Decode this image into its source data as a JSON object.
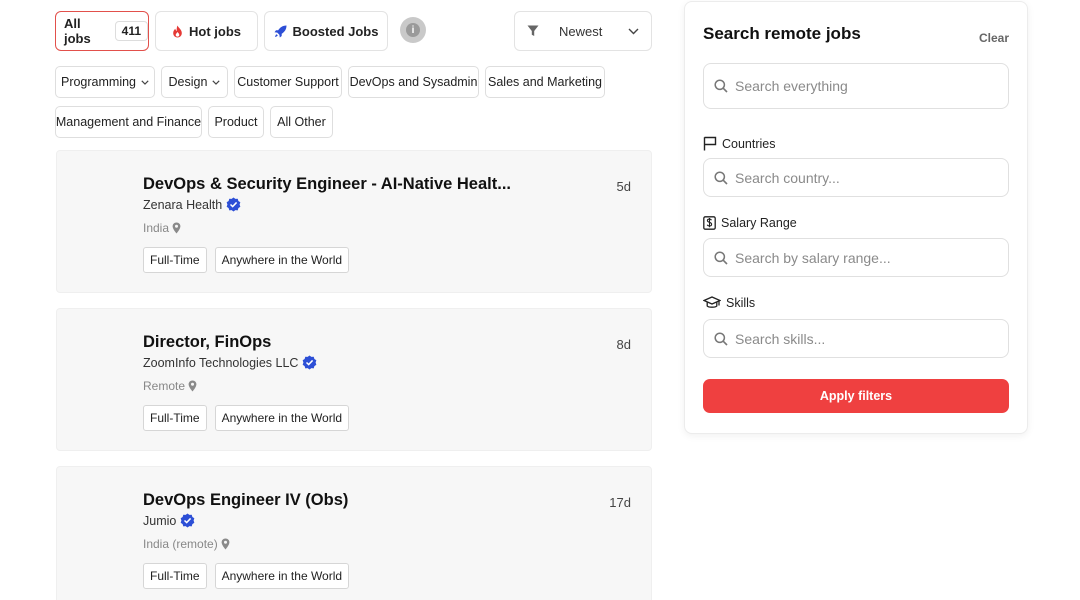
{
  "tabs": {
    "all_label": "All jobs",
    "all_count": "411",
    "hot_label": "Hot jobs",
    "boosted_label": "Boosted Jobs",
    "info_glyph": "i"
  },
  "sort": {
    "selected": "Newest"
  },
  "categories": [
    "Programming",
    "Design",
    "Customer Support",
    "DevOps and Sysadmin",
    "Sales and Marketing",
    "Management and Finance",
    "Product",
    "All Other"
  ],
  "jobs": [
    {
      "title": "DevOps & Security Engineer - AI-Native Healt...",
      "company": "Zenara Health",
      "location": "India",
      "age": "5d",
      "tags": [
        "Full-Time",
        "Anywhere in the World"
      ]
    },
    {
      "title": "Director, FinOps",
      "company": "ZoomInfo Technologies LLC",
      "location": "Remote",
      "age": "8d",
      "tags": [
        "Full-Time",
        "Anywhere in the World"
      ]
    },
    {
      "title": "DevOps Engineer IV (Obs)",
      "company": "Jumio",
      "location": "India (remote)",
      "age": "17d",
      "tags": [
        "Full-Time",
        "Anywhere in the World"
      ]
    }
  ],
  "panel": {
    "title": "Search remote jobs",
    "clear": "Clear",
    "search_placeholder": "Search everything",
    "countries_label": "Countries",
    "countries_placeholder": "Search country...",
    "salary_label": "Salary Range",
    "salary_placeholder": "Search by salary range...",
    "skills_label": "Skills",
    "skills_placeholder": "Search skills...",
    "apply_label": "Apply filters"
  },
  "colors": {
    "accent": "#ef4040",
    "verified": "#2d4fd6"
  }
}
